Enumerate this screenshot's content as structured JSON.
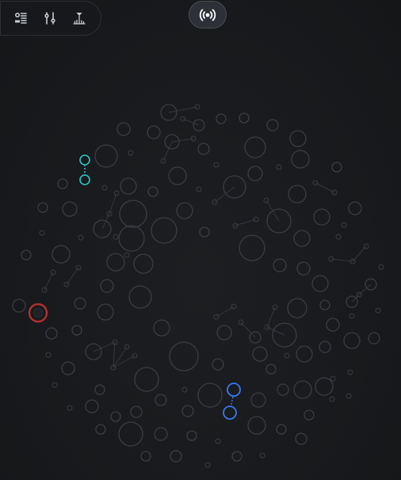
{
  "toolbar": {
    "icons": [
      "filter-list-icon",
      "sliders-icon",
      "histogram-filter-icon"
    ],
    "icon_color": "#c7ccd4"
  },
  "broadcast": {
    "icon": "broadcast-icon",
    "icon_color": "#ffffff"
  },
  "graph": {
    "node_stroke": "#3a3d42",
    "edge_stroke": "#34373c",
    "highlight_colors": {
      "teal": "#2ec4c4",
      "blue": "#3a78f2",
      "red": "#b03030"
    }
  }
}
